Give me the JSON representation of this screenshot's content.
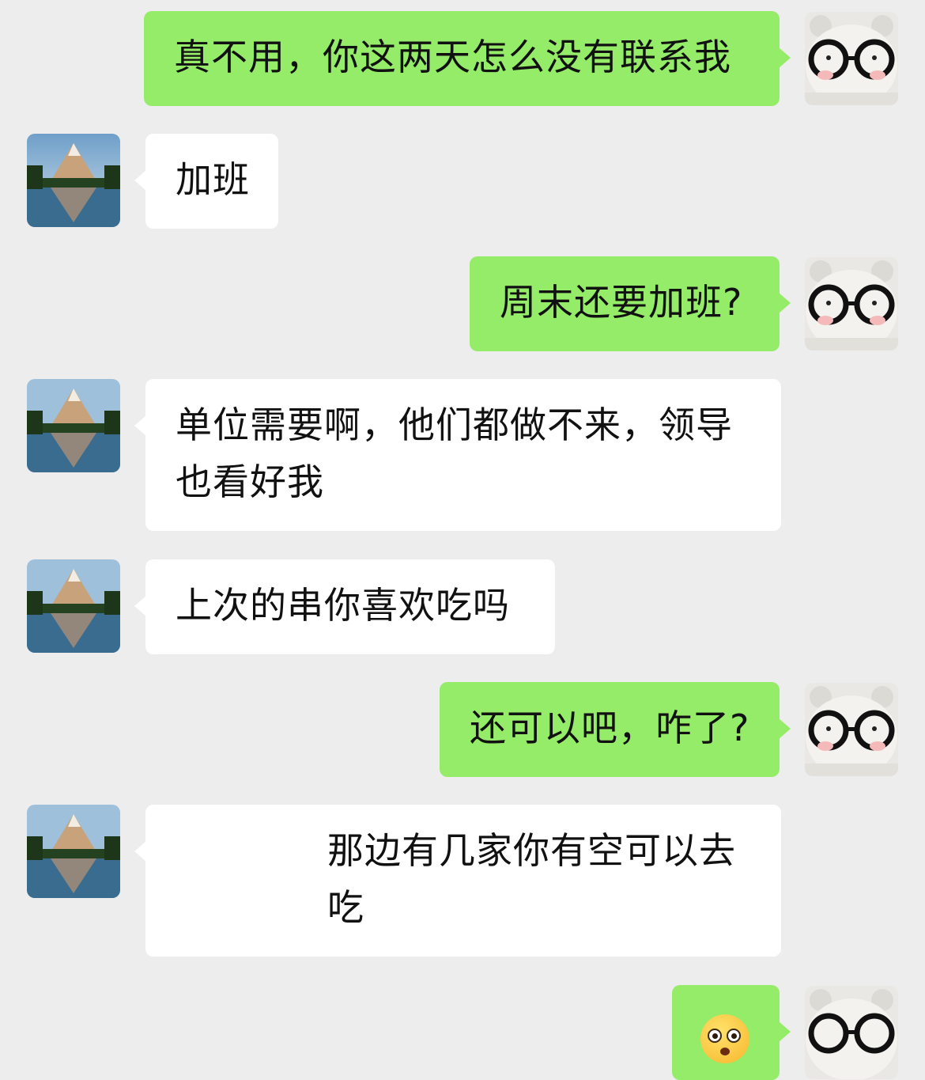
{
  "chat": {
    "messages": [
      {
        "sender": "me",
        "text": "真不用，你这两天怎么没有联系我"
      },
      {
        "sender": "them",
        "text": "加班"
      },
      {
        "sender": "me",
        "text": "周末还要加班?"
      },
      {
        "sender": "them",
        "text": "单位需要啊，他们都做不来，领导也看好我"
      },
      {
        "sender": "them",
        "text": "上次的串你喜欢吃吗"
      },
      {
        "sender": "me",
        "text": "还可以吧，咋了?"
      },
      {
        "sender": "them",
        "text": "那边有几家你有空可以去吃"
      },
      {
        "sender": "me",
        "emoji": "flushed-face-emoji"
      }
    ]
  },
  "colors": {
    "background": "#ededed",
    "me_bubble": "#95ec69",
    "them_bubble": "#ffffff"
  }
}
